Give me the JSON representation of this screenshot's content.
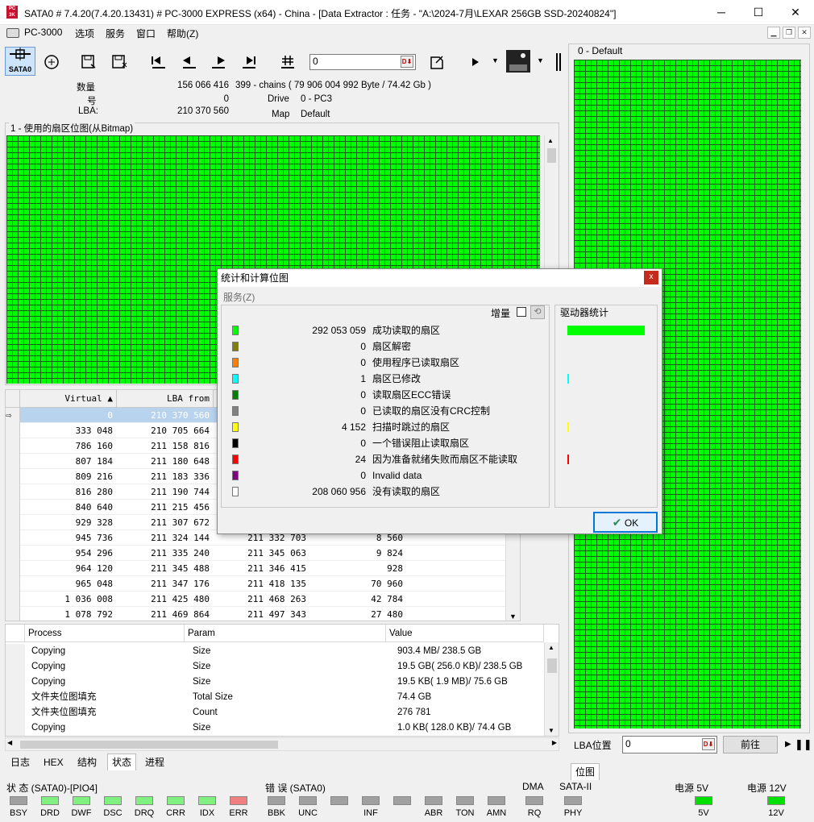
{
  "window": {
    "title": "SATA0 # 7.4.20(7.4.20.13431) # PC-3000 EXPRESS (x64) - China - [Data Extractor : 任务 - \"A:\\2024-7月\\LEXAR 256GB SSD-20240824\"]",
    "controls": {
      "min": "─",
      "max": "☐",
      "close": "✕"
    }
  },
  "menu": {
    "app": "PC-3000",
    "items": [
      "选项",
      "服务",
      "窗口",
      "帮助(Z)"
    ]
  },
  "toolbar": {
    "sata_label": "SATA0",
    "lba_value": "0",
    "go_glyph": "D⬇"
  },
  "info": {
    "count_label": "数量",
    "count_value": "156 066 416",
    "chains": "399 - chains  ( 79 906 004 992 Byte /  74.42 Gb )",
    "num_label": "号",
    "num_value": "0",
    "drive_label": "Drive",
    "drive_value": "0 - PC3",
    "lba_label": "LBA:",
    "lba_value": "210 370 560",
    "map_label": "Map",
    "map_value": "Default"
  },
  "bitmap": {
    "title": "1 - 使用的扇区位图(从Bitmap)"
  },
  "chain_table": {
    "headers": [
      "Virtual ▲",
      "LBA from",
      "",
      ""
    ],
    "rows": [
      [
        "0",
        "210 370 560",
        "",
        ""
      ],
      [
        "333 048",
        "210 705 664",
        "",
        ""
      ],
      [
        "786 160",
        "211 158 816",
        "",
        ""
      ],
      [
        "807 184",
        "211 180 648",
        "",
        ""
      ],
      [
        "809 216",
        "211 183 336",
        "",
        ""
      ],
      [
        "816 280",
        "211 190 744",
        "",
        ""
      ],
      [
        "840 640",
        "211 215 456",
        "",
        ""
      ],
      [
        "929 328",
        "211 307 672",
        "",
        ""
      ],
      [
        "945 736",
        "211 324 144",
        "211 332 703",
        "8 560"
      ],
      [
        "954 296",
        "211 335 240",
        "211 345 063",
        "9 824"
      ],
      [
        "964 120",
        "211 345 488",
        "211 346 415",
        "928"
      ],
      [
        "965 048",
        "211 347 176",
        "211 418 135",
        "70 960"
      ],
      [
        "1 036 008",
        "211 425 480",
        "211 468 263",
        "42 784"
      ],
      [
        "1 078 792",
        "211 469 864",
        "211 497 343",
        "27 480"
      ]
    ]
  },
  "process_table": {
    "headers": [
      "Process",
      "Param",
      "Value"
    ],
    "rows": [
      [
        "Copying",
        "Size",
        "903.4 MB/ 238.5 GB"
      ],
      [
        "Copying",
        "Size",
        "19.5 GB( 256.0 KB)/ 238.5 GB"
      ],
      [
        "Copying",
        "Size",
        "19.5 KB( 1.9 MB)/ 75.6 GB"
      ],
      [
        "文件夹位图填充",
        "Total Size",
        "74.4 GB"
      ],
      [
        "文件夹位图填充",
        "Count",
        "276 781"
      ],
      [
        "Copying",
        "Size",
        "1.0 KB( 128.0 KB)/ 74.4 GB"
      ]
    ]
  },
  "tabs": [
    "日志",
    "HEX",
    "结构",
    "状态",
    "进程"
  ],
  "status": {
    "state_label": "状 态 (SATA0)-[PIO4]",
    "state_leds": [
      {
        "n": "BSY",
        "c": "#a0a0a0"
      },
      {
        "n": "DRD",
        "c": "#80f080"
      },
      {
        "n": "DWF",
        "c": "#80f080"
      },
      {
        "n": "DSC",
        "c": "#80f080"
      },
      {
        "n": "DRQ",
        "c": "#80f080"
      },
      {
        "n": "CRR",
        "c": "#80f080"
      },
      {
        "n": "IDX",
        "c": "#80f080"
      },
      {
        "n": "ERR",
        "c": "#f08080"
      }
    ],
    "error_label": "错 误 (SATA0)",
    "error_leds": [
      {
        "n": "BBK",
        "c": "#a0a0a0"
      },
      {
        "n": "UNC",
        "c": "#a0a0a0"
      },
      {
        "n": "",
        "c": "#a0a0a0"
      },
      {
        "n": "INF",
        "c": "#a0a0a0"
      },
      {
        "n": "",
        "c": "#a0a0a0"
      },
      {
        "n": "ABR",
        "c": "#a0a0a0"
      },
      {
        "n": "TON",
        "c": "#a0a0a0"
      },
      {
        "n": "AMN",
        "c": "#a0a0a0"
      }
    ],
    "dma_label": "DMA",
    "dma_led": "RQ",
    "sata_label": "SATA-II",
    "sata_led": "PHY",
    "p5_label": "电源 5V",
    "p5_led": "5V",
    "p12_label": "电源 12V",
    "p12_led": "12V"
  },
  "right_panel": {
    "title": "0 - Default",
    "lba_label": "LBA位置",
    "lba_value": "0",
    "forward": "前往",
    "pos_tab": "位图"
  },
  "dialog": {
    "title": "统计和计算位图",
    "close": "x",
    "menu": "服务(Z)",
    "increment": "增量",
    "drive_stats": "驱动器统计",
    "ok": "OK",
    "stats": [
      {
        "color": "#00ff00",
        "value": "292 053 059",
        "label": "成功读取的扇区"
      },
      {
        "color": "#808000",
        "value": "0",
        "label": "扇区解密"
      },
      {
        "color": "#ff8000",
        "value": "0",
        "label": "使用程序已读取扇区"
      },
      {
        "color": "#00ffff",
        "value": "1",
        "label": "扇区已修改"
      },
      {
        "color": "#008000",
        "value": "0",
        "label": "读取扇区ECC错误"
      },
      {
        "color": "#808080",
        "value": "0",
        "label": "已读取的扇区没有CRC控制"
      },
      {
        "color": "#ffff00",
        "value": "4 152",
        "label": "扫描时跳过的扇区"
      },
      {
        "color": "#000000",
        "value": "0",
        "label": "一个错误阻止读取扇区"
      },
      {
        "color": "#ff0000",
        "value": "24",
        "label": "因为准备就绪失败而扇区不能读取"
      },
      {
        "color": "#800080",
        "value": "0",
        "label": "Invalid data"
      },
      {
        "color": "#ffffff",
        "value": "208 060 956",
        "label": "没有读取的扇区"
      }
    ]
  }
}
